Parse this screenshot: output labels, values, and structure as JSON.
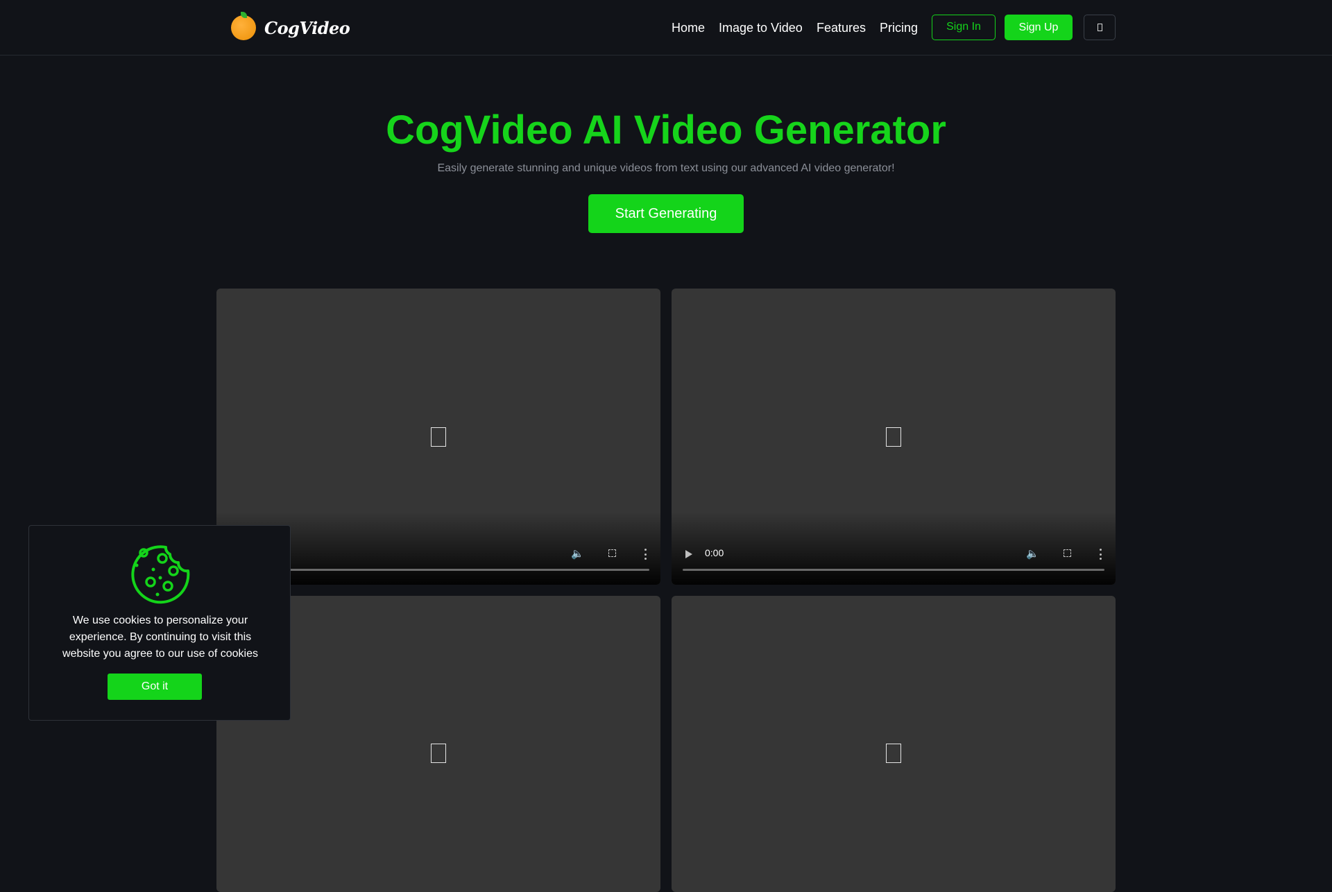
{
  "brand": {
    "name": "CogVideo",
    "logo_icon": "orange-fruit-icon"
  },
  "nav": {
    "links": [
      "Home",
      "Image to Video",
      "Features",
      "Pricing"
    ],
    "sign_in": "Sign In",
    "sign_up": "Sign Up",
    "theme_toggle_icon": "theme-toggle-icon"
  },
  "hero": {
    "title": "CogVideo AI Video Generator",
    "subtitle": "Easily generate stunning and unique videos from text using our advanced AI video generator!",
    "cta": "Start Generating"
  },
  "videos": [
    {
      "time": ""
    },
    {
      "time": "0:00"
    },
    {
      "time": ""
    },
    {
      "time": ""
    }
  ],
  "cookie": {
    "text": "We use cookies to personalize your experience. By continuing to visit this website you agree to our use of cookies",
    "button": "Got it",
    "icon": "cookie-icon"
  },
  "colors": {
    "accent": "#14d41a",
    "background": "#111318",
    "video_bg": "#363636",
    "subtitle": "#8b8f98"
  }
}
